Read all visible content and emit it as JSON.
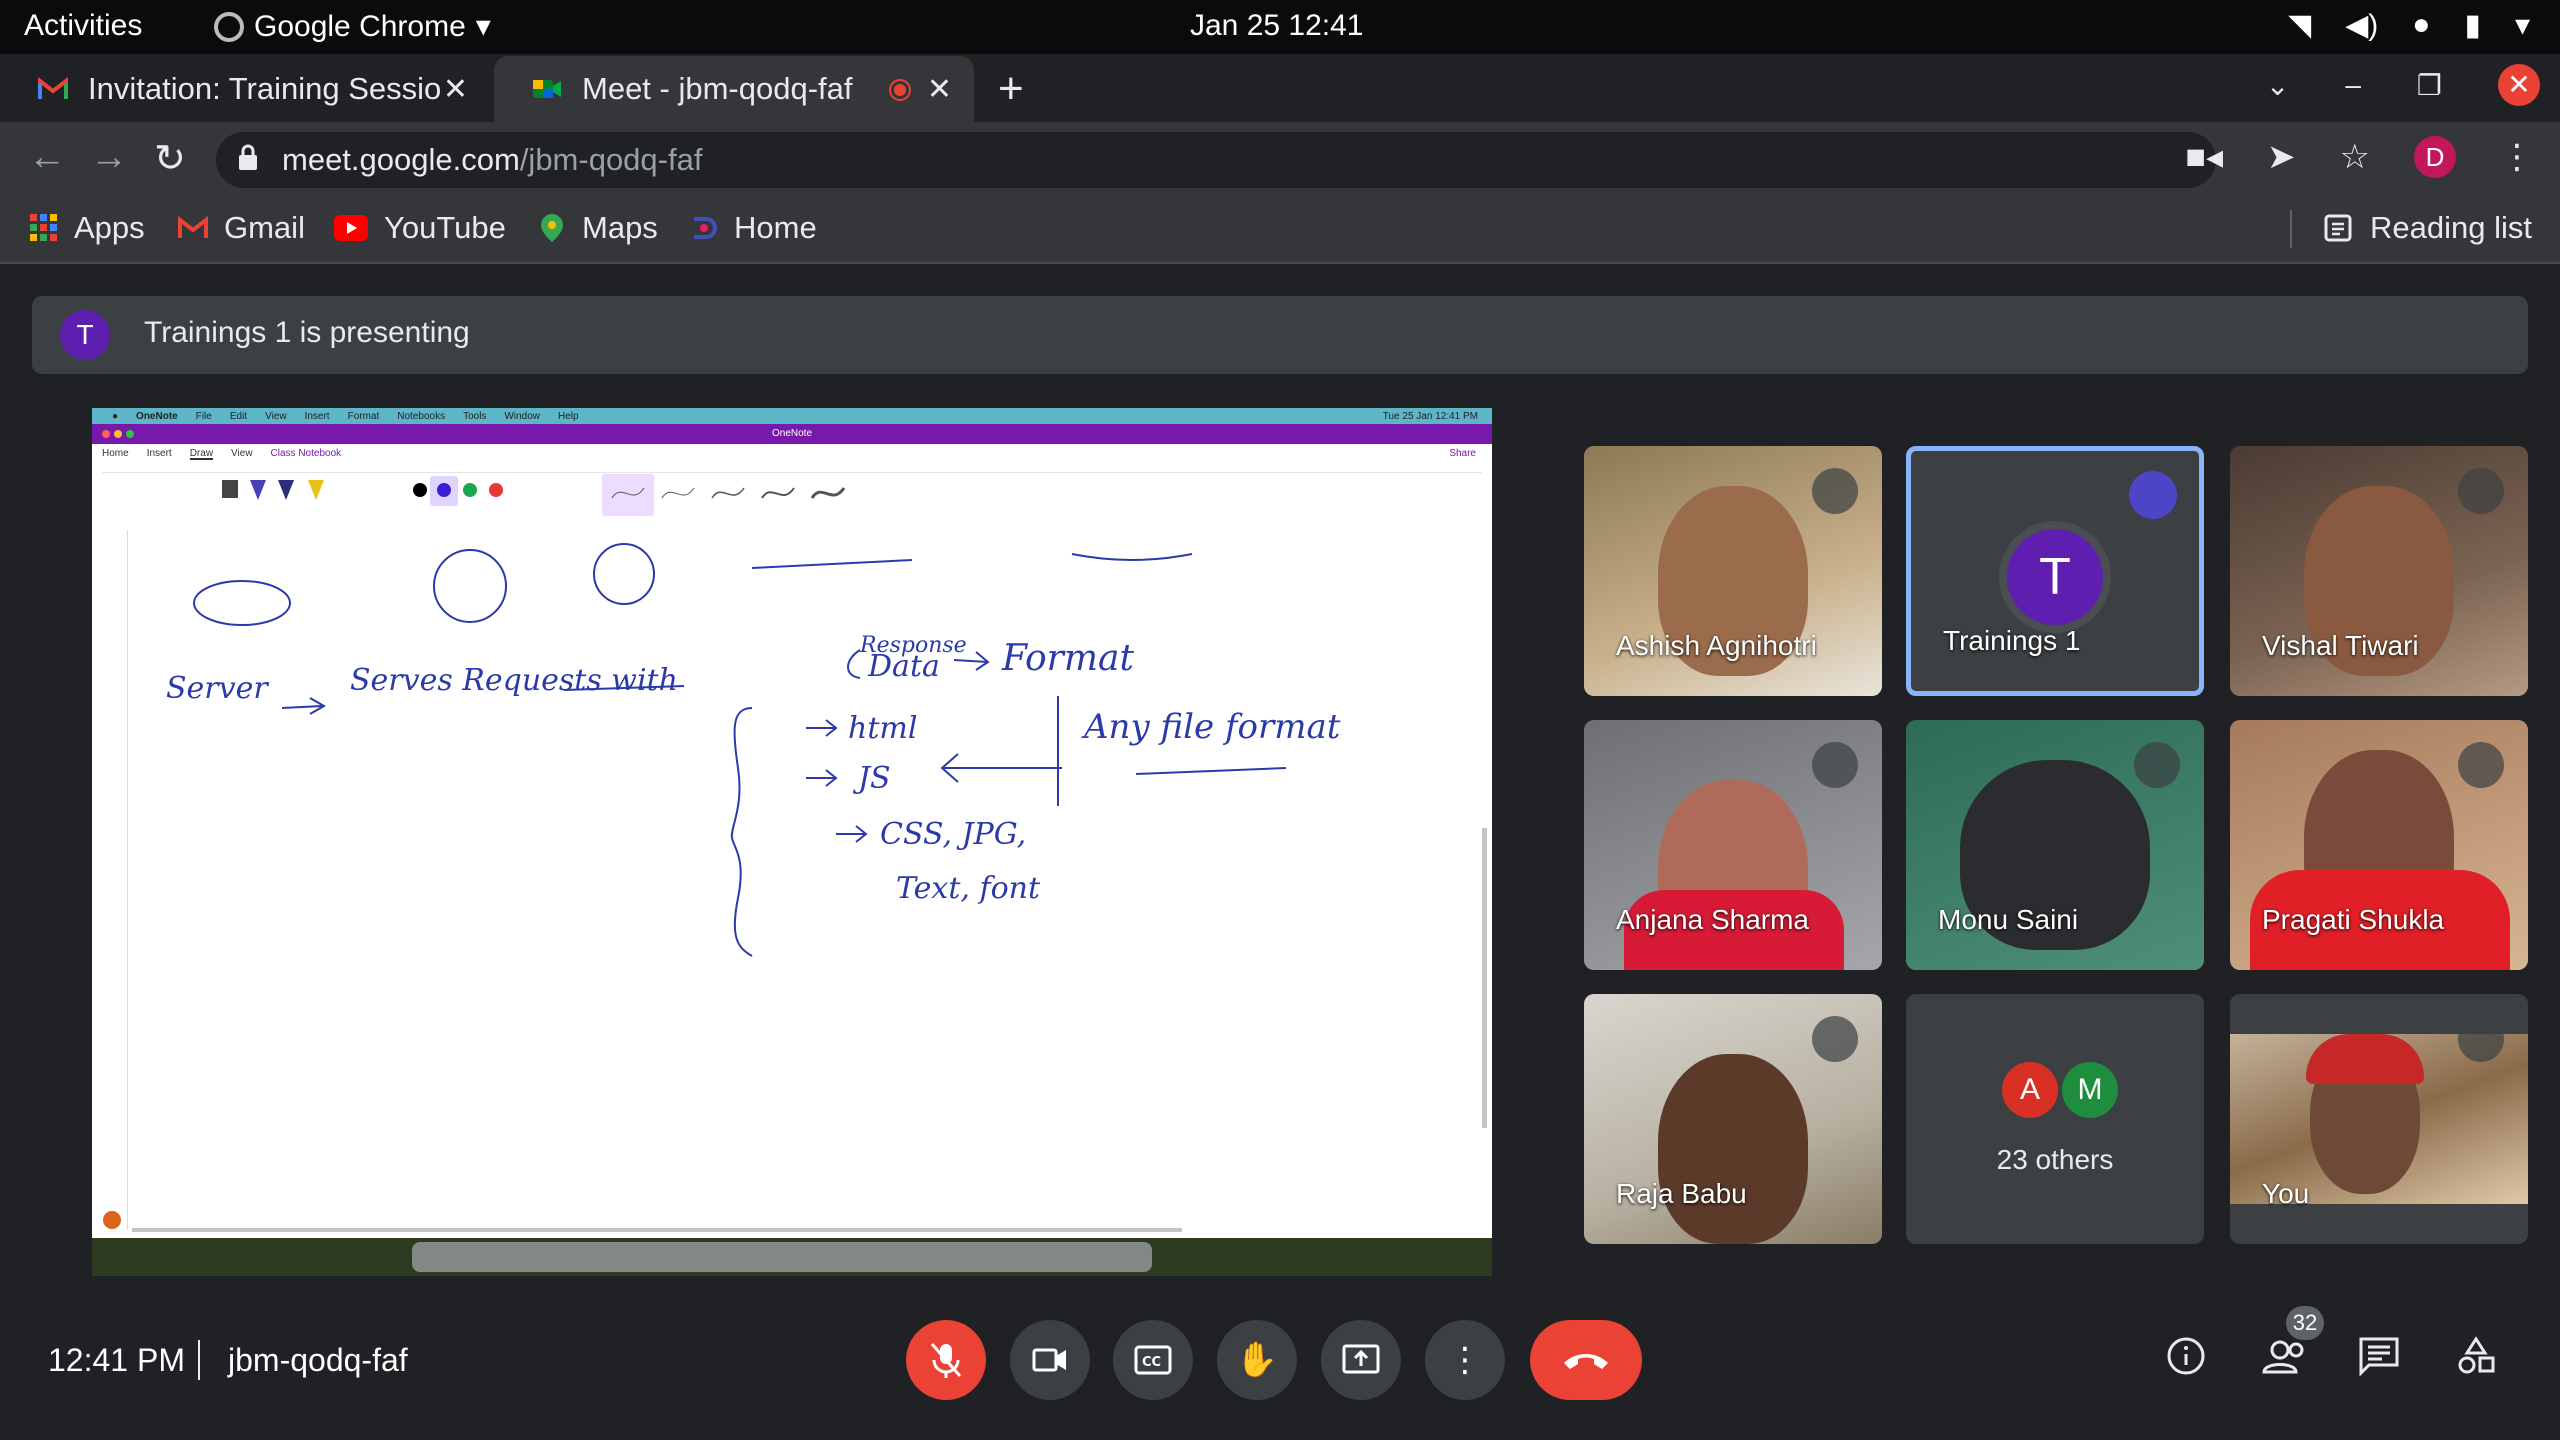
{
  "os": {
    "activities": "Activities",
    "app_name": "Google Chrome",
    "clock": "Jan 25  12:41"
  },
  "tabs": [
    {
      "title": "Invitation: Training Sessio",
      "close": "✕"
    },
    {
      "title": "Meet - jbm-qodq-faf",
      "close": "✕"
    }
  ],
  "new_tab": "+",
  "address": {
    "host": "meet.google.com",
    "path": "/jbm-qodq-faf",
    "profile_initial": "D"
  },
  "bookmarks": {
    "items": [
      "Apps",
      "Gmail",
      "YouTube",
      "Maps",
      "Home"
    ],
    "reading_list": "Reading list"
  },
  "meet": {
    "presenting_initial": "T",
    "presenting_text": "Trainings 1 is presenting",
    "participants": [
      {
        "name": "Ashish Agnihotri"
      },
      {
        "name": "Trainings 1",
        "initial": "T"
      },
      {
        "name": "Vishal Tiwari"
      },
      {
        "name": "Anjana Sharma"
      },
      {
        "name": "Monu Saini"
      },
      {
        "name": "Pragati Shukla"
      },
      {
        "name": "Raja Babu"
      },
      {
        "name": "23 others",
        "initials": [
          "A",
          "M"
        ]
      },
      {
        "name": "You"
      }
    ],
    "time": "12:41 PM",
    "meeting_code": "jbm-qodq-faf",
    "people_count": "32"
  },
  "shared_screen": {
    "mac_menu": [
      "OneNote",
      "File",
      "Edit",
      "View",
      "Insert",
      "Format",
      "Notebooks",
      "Tools",
      "Window",
      "Help"
    ],
    "mac_clock": "Tue 25 Jan  12:41 PM",
    "window_title": "OneNote",
    "ribbon_tabs": [
      "Home",
      "Insert",
      "Draw",
      "View",
      "Class Notebook"
    ],
    "share_label": "Share",
    "ink_text": {
      "line1_a": "Server",
      "line1_b": "Serves Requests with",
      "line1_data": "Data",
      "line1_response": "Response",
      "line1_c": "Format",
      "brace_1": "html",
      "brace_2": "JS",
      "brace_3": "CSS, JPG,",
      "brace_4": "Text, font",
      "side": "Any file format"
    }
  },
  "colors": {
    "meet_bg": "#202124",
    "tile_bg": "#3c4043",
    "end_call": "#ea4335",
    "onenote_purple": "#7719aa",
    "ink_blue": "#2b3aa8",
    "speaking_border": "#8ab4f8"
  }
}
